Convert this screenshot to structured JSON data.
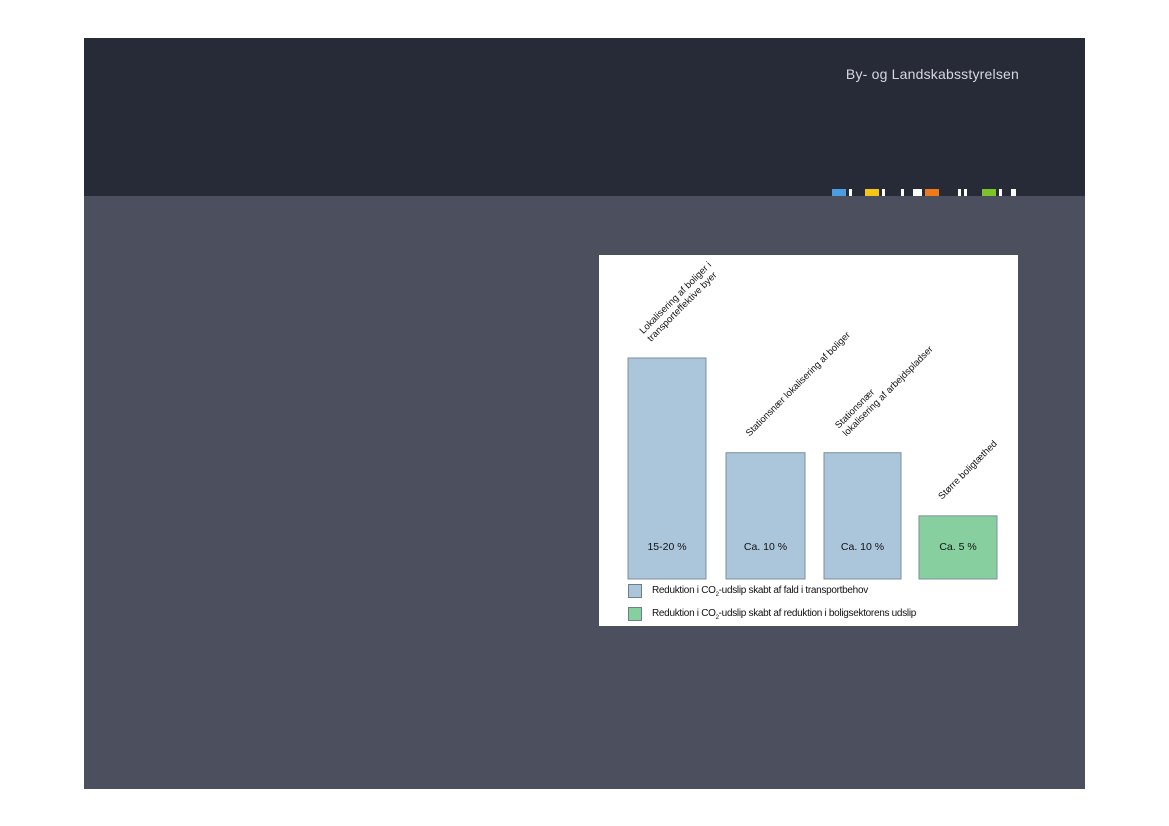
{
  "header": {
    "org_name": "By- og Landskabsstyrelsen"
  },
  "colors": {
    "slide_bg": "#4b4f5e",
    "header_bg": "#272b37",
    "bar_transport": "#abc6db",
    "bar_housing": "#88cfa0",
    "strip": [
      "#4a9de0",
      "#f5c518",
      "#ef7a1a",
      "#7cc42a",
      "#ffffff"
    ]
  },
  "chart_data": {
    "type": "bar",
    "categories": [
      "Lokalisering af boliger i transporteffektive byer",
      "Stationsnær lokalisering af boliger",
      "Stationsnær lokalisering af arbejdspladser",
      "Større boligtæthed"
    ],
    "category_lines": [
      [
        "Lokalisering af boliger i",
        "transporteffektive byer"
      ],
      [
        "Stationsnær lokalisering af boliger"
      ],
      [
        "Stationsnær",
        "lokalisering af arbejdspladser"
      ],
      [
        "Større boligtæthed"
      ]
    ],
    "values": [
      17.5,
      10,
      10,
      5
    ],
    "value_labels": [
      "15-20 %",
      "Ca. 10 %",
      "Ca. 10 %",
      "Ca. 5 %"
    ],
    "bar_types": [
      "transport",
      "transport",
      "transport",
      "housing"
    ],
    "ylim": [
      0,
      17.5
    ],
    "legend": [
      {
        "key": "transport",
        "pre": "Reduktion i CO",
        "sub": "2",
        "post": "-udslip skabt af fald i transportbehov"
      },
      {
        "key": "housing",
        "pre": "Reduktion i CO",
        "sub": "2",
        "post": "-udslip skabt af reduktion i boligsektorens udslip"
      }
    ]
  }
}
